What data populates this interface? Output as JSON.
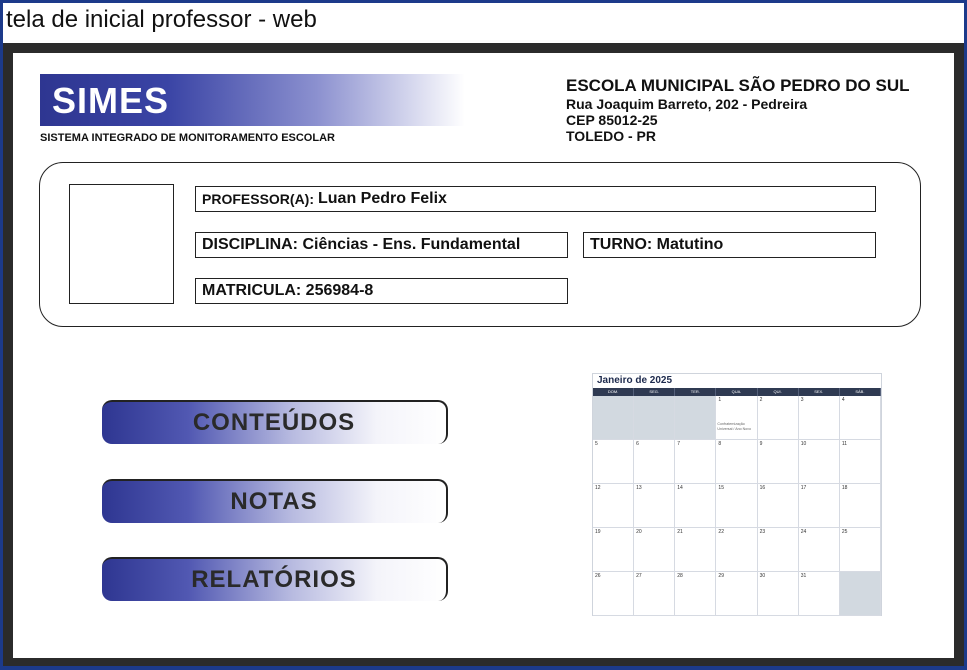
{
  "window": {
    "title": "tela de inicial professor - web"
  },
  "logo": {
    "text": "SIMES",
    "subtitle": "SISTEMA INTEGRADO DE MONITORAMENTO ESCOLAR"
  },
  "school": {
    "name": "ESCOLA MUNICIPAL SÃO PEDRO DO SUL",
    "address": "Rua Joaquim Barreto, 202 - Pedreira",
    "cep": "CEP 85012-25",
    "city": "TOLEDO - PR"
  },
  "teacher": {
    "professor_label": "PROFESSOR(A):",
    "professor_value": "Luan Pedro Felix",
    "disciplina": "DISCIPLINA: Ciências - Ens. Fundamental",
    "turno": "TURNO: Matutino",
    "matricula": "MATRICULA: 256984-8"
  },
  "menu": {
    "conteudos": "CONTEÚDOS",
    "notas": "NOTAS",
    "relatorios": "RELATÓRIOS"
  },
  "calendar": {
    "title": "Janeiro de 2025",
    "weekdays": [
      "DOM.",
      "SEG.",
      "TER.",
      "QUA.",
      "QUI.",
      "SEX.",
      "SÁB."
    ],
    "cells": [
      {
        "n": "",
        "shade": true
      },
      {
        "n": "",
        "shade": true
      },
      {
        "n": "",
        "shade": true
      },
      {
        "n": "1",
        "event": "Confraternização Universal / Ano Novo"
      },
      {
        "n": "2"
      },
      {
        "n": "3"
      },
      {
        "n": "4"
      },
      {
        "n": "5"
      },
      {
        "n": "6"
      },
      {
        "n": "7"
      },
      {
        "n": "8"
      },
      {
        "n": "9"
      },
      {
        "n": "10"
      },
      {
        "n": "11"
      },
      {
        "n": "12"
      },
      {
        "n": "13"
      },
      {
        "n": "14"
      },
      {
        "n": "15"
      },
      {
        "n": "16"
      },
      {
        "n": "17"
      },
      {
        "n": "18"
      },
      {
        "n": "19"
      },
      {
        "n": "20"
      },
      {
        "n": "21"
      },
      {
        "n": "22"
      },
      {
        "n": "23"
      },
      {
        "n": "24"
      },
      {
        "n": "25"
      },
      {
        "n": "26"
      },
      {
        "n": "27"
      },
      {
        "n": "28"
      },
      {
        "n": "29"
      },
      {
        "n": "30"
      },
      {
        "n": "31"
      },
      {
        "n": "",
        "shade": true
      }
    ]
  },
  "colors": {
    "frame": "#1c3a8a",
    "brand": "#2e3691",
    "page": "#ffffff"
  }
}
